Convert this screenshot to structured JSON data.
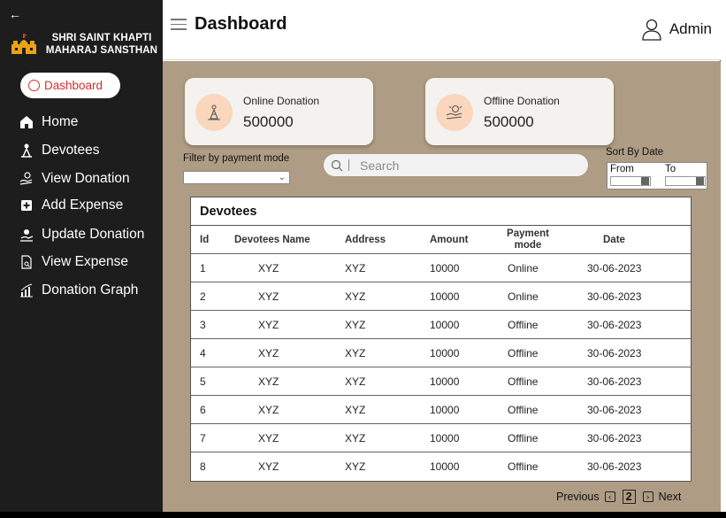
{
  "sidebar": {
    "org_name": "SHRI SAINT KHAPTI MAHARAJ SANSTHAN",
    "active_item": "Dashboard",
    "items": [
      {
        "label": "Home",
        "icon": "home-icon"
      },
      {
        "label": "Devotees",
        "icon": "devotee-icon"
      },
      {
        "label": "View Donation",
        "icon": "donation-icon"
      },
      {
        "label": "Add Expense",
        "icon": "plus-square-icon"
      },
      {
        "label": "Update Donation",
        "icon": "update-icon"
      },
      {
        "label": "View Expense",
        "icon": "document-search-icon"
      },
      {
        "label": "Donation Graph",
        "icon": "bar-graph-icon"
      }
    ]
  },
  "header": {
    "title": "Dashboard",
    "user": "Admin"
  },
  "cards": {
    "online": {
      "label": "Online Donation",
      "value": "500000"
    },
    "offline": {
      "label": "Offline Donation",
      "value": "500000"
    }
  },
  "filters": {
    "payment_mode_label": "Filter by payment mode",
    "search_placeholder": "Search",
    "sort_label": "Sort By Date",
    "from_label": "From",
    "to_label": "To"
  },
  "table": {
    "title": "Devotees",
    "columns": [
      "Id",
      "Devotees Name",
      "Address",
      "Amount",
      "Payment mode",
      "Date"
    ],
    "rows": [
      [
        "1",
        "XYZ",
        "XYZ",
        "10000",
        "Online",
        "30-06-2023"
      ],
      [
        "2",
        "XYZ",
        "XYZ",
        "10000",
        "Online",
        "30-06-2023"
      ],
      [
        "3",
        "XYZ",
        "XYZ",
        "10000",
        "Offline",
        "30-06-2023"
      ],
      [
        "4",
        "XYZ",
        "XYZ",
        "10000",
        "Offline",
        "30-06-2023"
      ],
      [
        "5",
        "XYZ",
        "XYZ",
        "10000",
        "Offline",
        "30-06-2023"
      ],
      [
        "6",
        "XYZ",
        "XYZ",
        "10000",
        "Offline",
        "30-06-2023"
      ],
      [
        "7",
        "XYZ",
        "XYZ",
        "10000",
        "Offline",
        "30-06-2023"
      ],
      [
        "8",
        "XYZ",
        "XYZ",
        "10000",
        "Offline",
        "30-06-2023"
      ]
    ]
  },
  "pagination": {
    "previous": "Previous",
    "current_page": "2",
    "next": "Next"
  },
  "colors": {
    "sidebar_bg": "#1d1d1d",
    "main_bg": "#ae9c84",
    "accent_red": "#d32f2f",
    "icon_circle": "#fad6bc",
    "logo_gold": "#e8a317"
  }
}
